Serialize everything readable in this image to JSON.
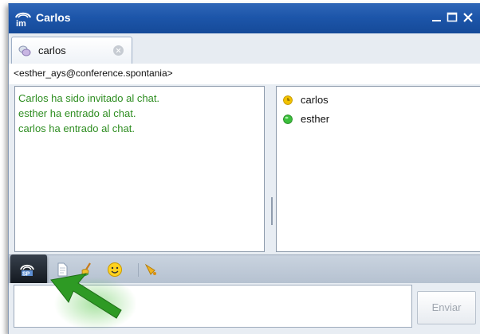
{
  "window": {
    "title": "Carlos",
    "controls": [
      "minimize",
      "maximize",
      "close"
    ]
  },
  "tabs": [
    {
      "label": "carlos",
      "active": true
    }
  ],
  "room": {
    "label": "<esther_ays@conference.spontania>"
  },
  "chat": {
    "messages": [
      "Carlos ha sido invitado al chat.",
      "esther ha entrado al chat.",
      "carlos ha entrado al chat."
    ],
    "message_color": "#2f8e22"
  },
  "participants": [
    {
      "name": "carlos",
      "status": "away",
      "status_color": "#e6b400"
    },
    {
      "name": "esther",
      "status": "online",
      "status_color": "#3cbf3c"
    }
  ],
  "toolbar": {
    "tools": [
      {
        "icon": "spontania-share-icon",
        "active": true
      },
      {
        "icon": "document-icon"
      },
      {
        "icon": "clear-brush-icon"
      },
      {
        "icon": "smiley-icon"
      },
      {
        "icon": "bell-icon"
      }
    ]
  },
  "compose": {
    "send_label": "Enviar",
    "send_enabled": false
  },
  "colors": {
    "title_bar": "#1d56aa",
    "accent_arrow": "#2e9a24",
    "panel_bg": "#e8edf3"
  }
}
